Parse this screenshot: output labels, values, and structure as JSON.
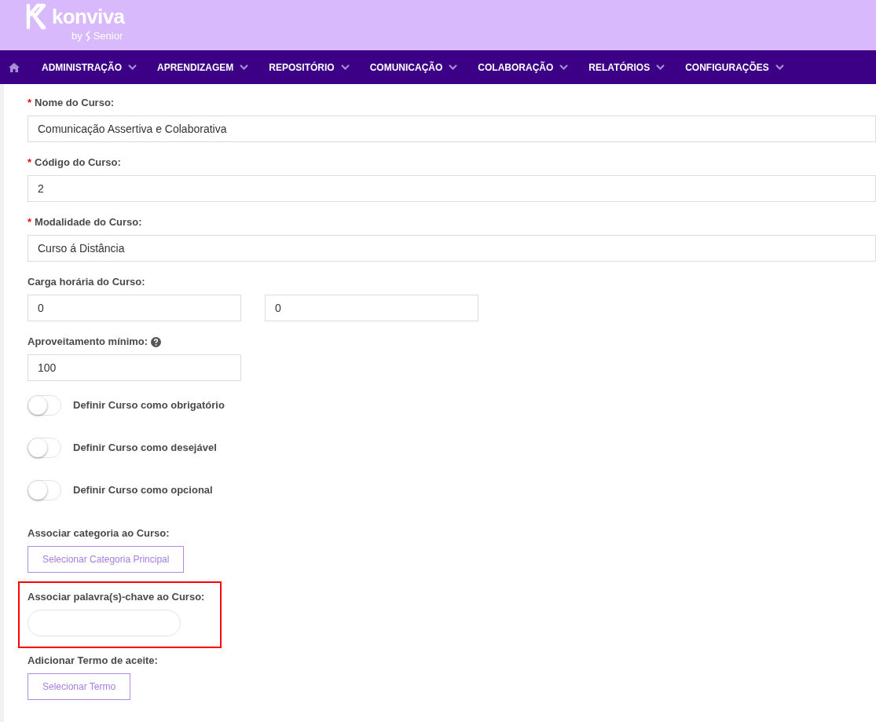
{
  "logo": {
    "name": "konviva",
    "by": "by",
    "brand": "Senior"
  },
  "nav": [
    {
      "label": "ADMINISTRAÇÃO"
    },
    {
      "label": "APRENDIZAGEM"
    },
    {
      "label": "REPOSITÓRIO"
    },
    {
      "label": "COMUNICAÇÃO"
    },
    {
      "label": "COLABORAÇÃO"
    },
    {
      "label": "RELATÓRIOS"
    },
    {
      "label": "CONFIGURAÇÕES"
    }
  ],
  "form": [
    {
      "kind": "input",
      "label": "Nome do Curso:",
      "marker": "*",
      "values": [
        "Comunicação Assertiva e Colaborativa"
      ],
      "full": true
    },
    {
      "kind": "input",
      "label": "Código do Curso:",
      "marker": "*",
      "values": [
        "2"
      ],
      "full": true
    },
    {
      "kind": "input",
      "label": "Modalidade do Curso:",
      "marker": "*",
      "values": [
        "Curso á Distância"
      ],
      "full": true
    },
    {
      "kind": "input",
      "label": "Carga horária do Curso:",
      "values": [
        "0",
        "0"
      ],
      "full": false
    },
    {
      "kind": "input",
      "label": "Aproveitamento mínimo:",
      "help": true,
      "values": [
        "100"
      ],
      "full": false
    },
    {
      "kind": "toggle",
      "label": "Definir Curso como obrigatório",
      "on": false
    },
    {
      "kind": "toggle",
      "label": "Definir Curso como desejável",
      "on": false
    },
    {
      "kind": "toggle",
      "label": "Definir Curso como opcional",
      "on": false
    },
    {
      "kind": "button",
      "label": "Associar categoria ao Curso:",
      "button": "Selecionar Categoria Principal"
    },
    {
      "kind": "tags",
      "label": "Associar palavra(s)-chave ao Curso:",
      "highlighted": true
    },
    {
      "kind": "button",
      "label": "Adicionar Termo de aceite:",
      "button": "Selecionar Termo"
    }
  ]
}
